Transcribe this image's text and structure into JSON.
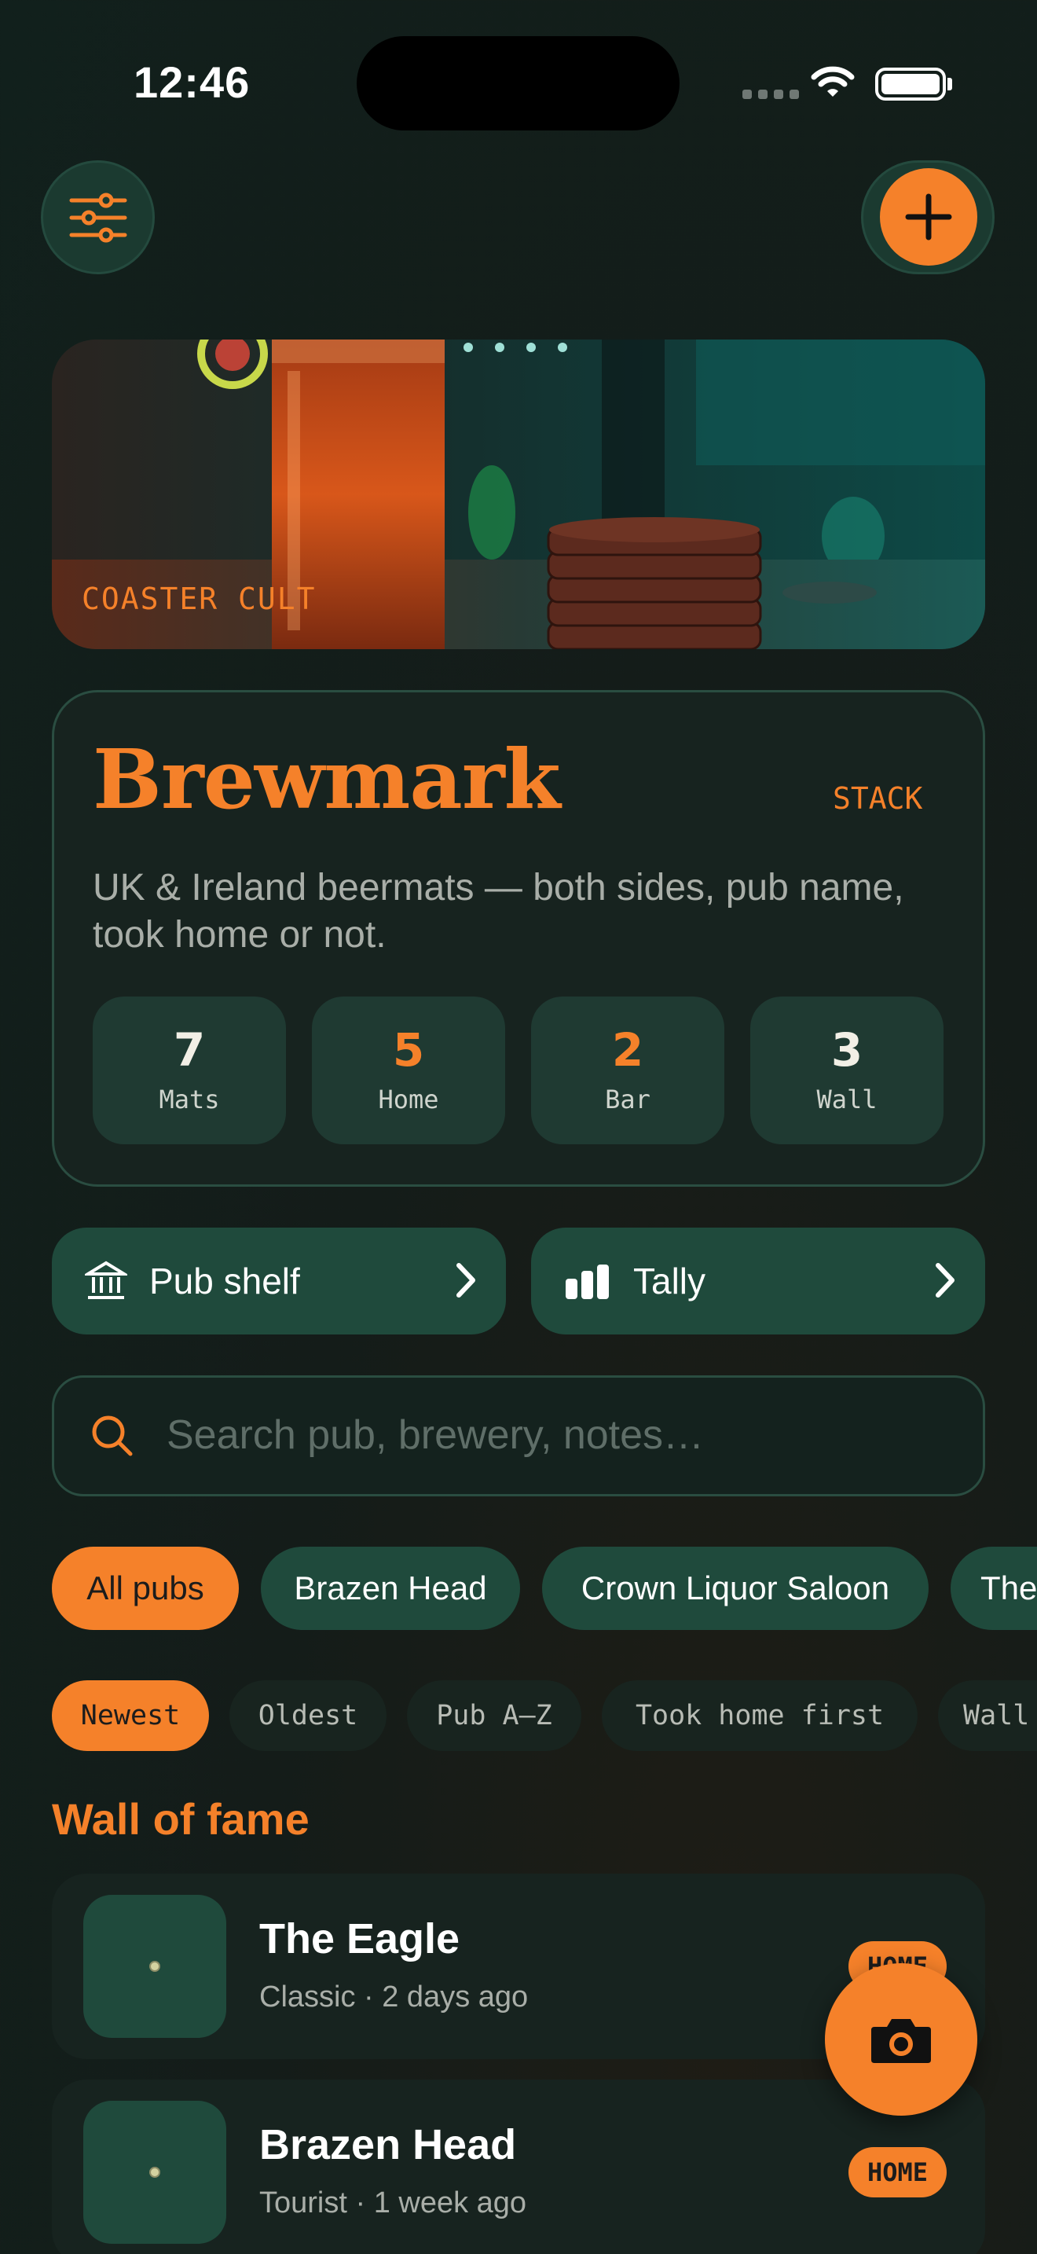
{
  "status_bar": {
    "time": "12:46"
  },
  "hero": {
    "label": "COASTER CULT"
  },
  "brand": {
    "title": "Brewmark",
    "mode": "STACK",
    "tagline": "UK & Ireland beermats — both sides, pub name, took home or not."
  },
  "stats": [
    {
      "value": "7",
      "label": "Mats",
      "color": "#f2efe6"
    },
    {
      "value": "5",
      "label": "Home",
      "color": "#f5812a"
    },
    {
      "value": "2",
      "label": "Bar",
      "color": "#f5812a"
    },
    {
      "value": "3",
      "label": "Wall",
      "color": "#f2efe6"
    }
  ],
  "nav": {
    "pub_shelf": {
      "label": "Pub shelf",
      "icon": "bank-icon"
    },
    "tally": {
      "label": "Tally",
      "icon": "bar-chart-icon"
    }
  },
  "search": {
    "placeholder": "Search pub, brewery, notes…",
    "value": ""
  },
  "pub_filters": [
    "All pubs",
    "Brazen Head",
    "Crown Liquor Saloon",
    "The"
  ],
  "sort_options": [
    "Newest",
    "Oldest",
    "Pub A–Z",
    "Took home first",
    "Wall"
  ],
  "section_title": "Wall of fame",
  "mats": [
    {
      "pub": "The Eagle",
      "meta": "Classic · 2 days ago",
      "badge": "HOME"
    },
    {
      "pub": "Brazen Head",
      "meta": "Tourist · 1 week ago",
      "badge": "HOME"
    }
  ],
  "colors": {
    "accent": "#f5812a",
    "green": "#1f4a3c",
    "card": "#17231f"
  }
}
